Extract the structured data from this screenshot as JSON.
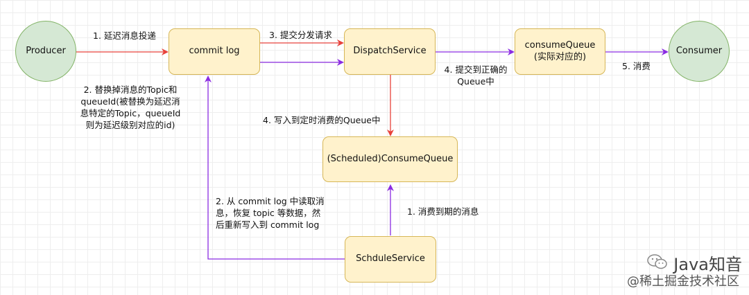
{
  "nodes": {
    "producer": "Producer",
    "commit_log": "commit log",
    "dispatch_service": "DispatchService",
    "consume_queue": "consumeQueue\n(实际对应的)",
    "consumer": "Consumer",
    "scheduled_queue": "(Scheduled)ConsumeQueue",
    "schedule_service": "SchduleService"
  },
  "edge_labels": {
    "e1": "1. 延迟消息投递",
    "e2": "2. 替换掉消息的Topic和\nqueueId(被替换为延迟消\n息特定的Topic，queueId\n则为延迟级别对应的id)",
    "e3": "3. 提交分发请求",
    "e4_correct": "4. 提交到正确的\nQueue中",
    "e4_scheduled": "4. 写入到定时消费的Queue中",
    "e5": "5. 消费",
    "s1": "1. 消费到期的消息",
    "s2": "2. 从 commit log 中读取消\n息，恢复 topic 等数据，然\n后重新写入到 commit log"
  },
  "colors": {
    "red_edge": "#e8413a",
    "purple_edge": "#8a2be2",
    "rect_fill": "#fff2cc",
    "rect_stroke": "#d6b656",
    "circle_fill": "#d5e8d4",
    "circle_stroke": "#82b366"
  },
  "watermark": {
    "brand": "Java知音",
    "sub": "@稀土掘金技术社区",
    "icon": "wechat-icon"
  }
}
